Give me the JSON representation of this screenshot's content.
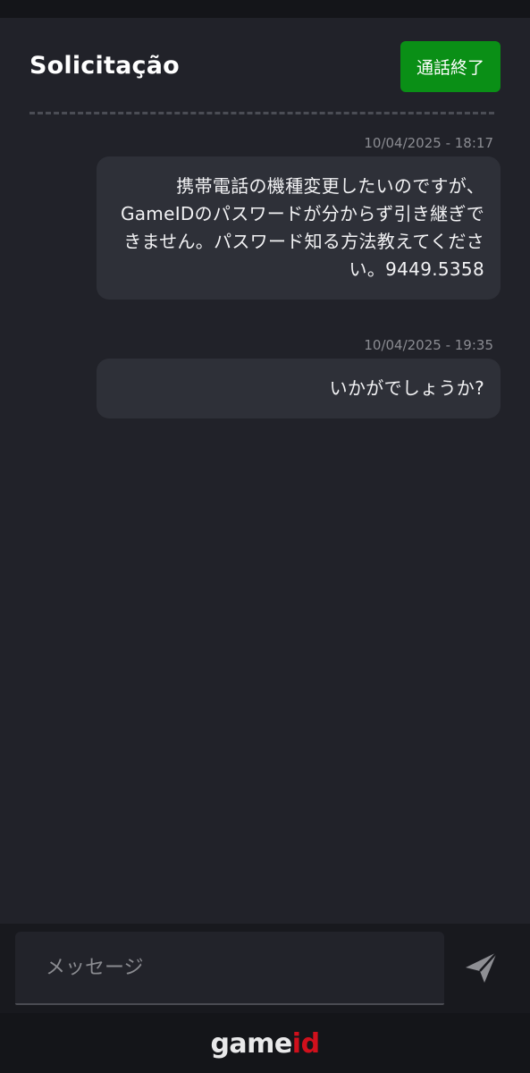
{
  "header": {
    "title": "Solicitação",
    "end_call_label": "通話終了"
  },
  "messages": [
    {
      "timestamp": "10/04/2025 - 18:17",
      "text": "携帯電話の機種変更したいのですが、GameIDのパスワードが分からず引き継ぎできません。パスワード知る方法教えてください。9449.5358"
    },
    {
      "timestamp": "10/04/2025 - 19:35",
      "text": "いかがでしょうか?"
    }
  ],
  "composer": {
    "placeholder": "メッセージ",
    "value": "",
    "send_icon": "send-icon"
  },
  "footer": {
    "logo_part1": "game",
    "logo_part2": "id"
  },
  "colors": {
    "background": "#212229",
    "bubble": "#2e3038",
    "accent_green": "#0a8f16",
    "logo_red": "#d0101c"
  }
}
